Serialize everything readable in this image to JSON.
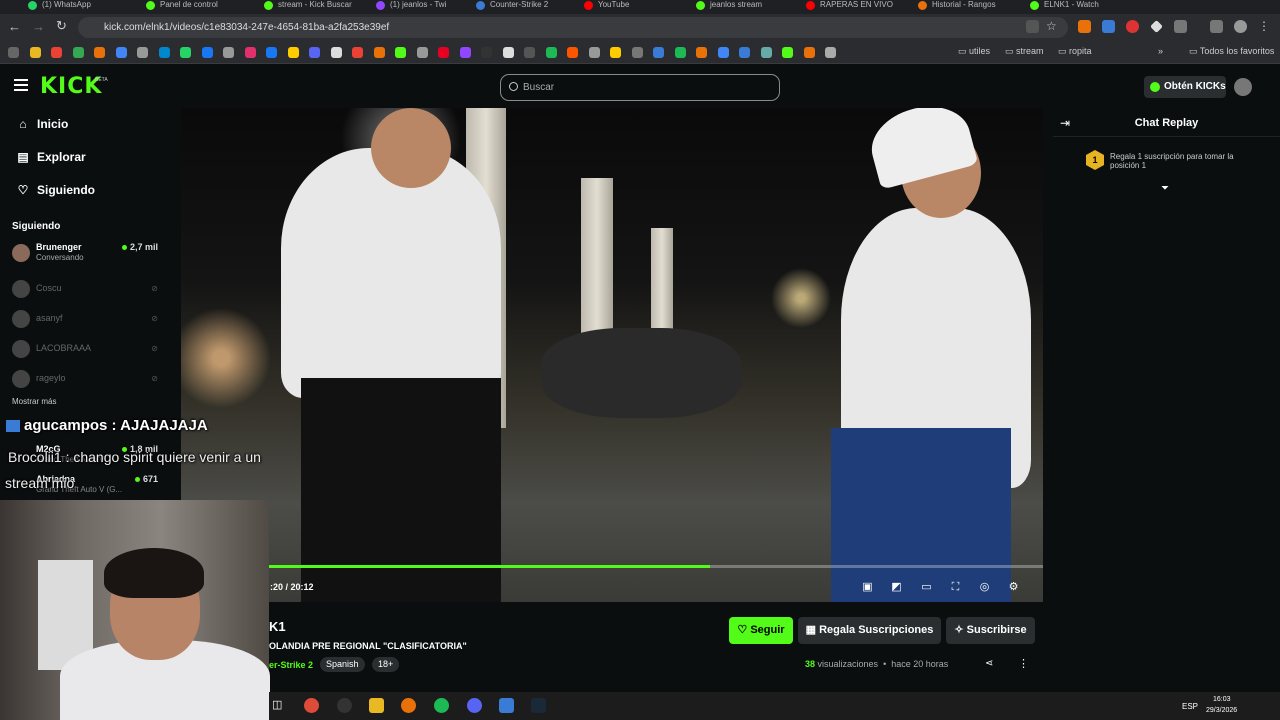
{
  "browser": {
    "tabs": [
      {
        "label": "(1) WhatsApp",
        "color": "#25d366"
      },
      {
        "label": "Panel de control",
        "color": "#53fc18"
      },
      {
        "label": "stream - Kick Buscar",
        "color": "#53fc18"
      },
      {
        "label": "(1) jeanlos - Twi",
        "color": "#9146ff"
      },
      {
        "label": "Counter-Strike 2",
        "color": "#3a7bd5"
      },
      {
        "label": "YouTube",
        "color": "#ff0000"
      },
      {
        "label": "jeanlos stream",
        "color": "#53fc18"
      },
      {
        "label": "RAPERAS EN VIVO",
        "color": "#ff0000"
      },
      {
        "label": "Historial - Rangos",
        "color": "#e8710a"
      },
      {
        "label": "ELNK1 - Watch",
        "color": "#53fc18"
      }
    ],
    "url": "kick.com/elnk1/videos/c1e83034-247e-4654-81ba-a2fa253e39ef",
    "bookmark_folders": [
      "utiles",
      "stream",
      "ropita"
    ],
    "all_bookmarks": "Todos los favoritos"
  },
  "header": {
    "logo": "KICK",
    "logo_badge": "BETA",
    "search_placeholder": "Buscar",
    "kicks_button": "Obtén KICKs"
  },
  "sidebar": {
    "nav": [
      {
        "label": "Inicio",
        "icon": "home-icon"
      },
      {
        "label": "Explorar",
        "icon": "compass-icon"
      },
      {
        "label": "Siguiendo",
        "icon": "heart-icon"
      }
    ],
    "following_title": "Siguiendo",
    "channels": [
      {
        "name": "Brunenger",
        "sub": "Conversando",
        "viewers": "2,7 mil",
        "live": true
      },
      {
        "name": "Coscu",
        "live": false
      },
      {
        "name": "asanyf",
        "live": false
      },
      {
        "name": "LACOBRAAA",
        "live": false
      },
      {
        "name": "rageylo",
        "live": false
      }
    ],
    "show_more": "Mostrar más",
    "partial_channels": [
      {
        "name": "M2cG",
        "viewers": "1,8 mil",
        "sub": "Grand Theft Auto V"
      },
      {
        "name": "Abriadna",
        "viewers": "671",
        "sub": "Grand Theft Auto V (G..."
      }
    ]
  },
  "overlay_chat": [
    {
      "user": "agucampos",
      "text": "agucampos : AJAJAJAJA"
    },
    {
      "user": "Brocolii1",
      "text": "Brocolii1 : chango spirit quiere venir a un"
    },
    {
      "user": "Brocolii1",
      "text": "stream mio"
    }
  ],
  "player": {
    "time": ":20 / 20:12",
    "progress": 0.57
  },
  "chat": {
    "title": "Chat Replay",
    "gift_rank": "1",
    "gift_text": "Regala 1 suscripción para tomar la posición 1"
  },
  "stream": {
    "channel": "K1",
    "title": "OLANDIA PRE REGIONAL \"CLASIFICATORIA\"",
    "category": "er-Strike 2",
    "tags": [
      "Spanish",
      "18+"
    ],
    "follow": "Seguir",
    "gift_subs": "Regala Suscripciones",
    "subscribe": "Suscribirse",
    "views_count": "38",
    "views_label": "visualizaciones",
    "age": "hace 20 horas"
  },
  "taskbar": {
    "lang": "ESP",
    "time": "16:03",
    "date": "29/3/2026"
  }
}
